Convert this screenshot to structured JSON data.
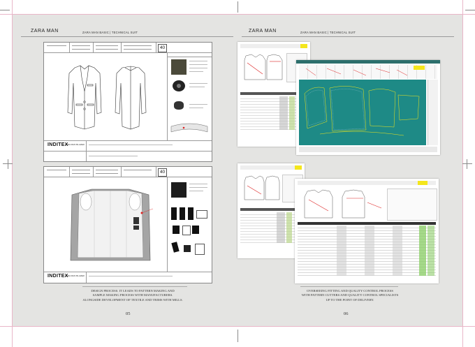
{
  "left_page": {
    "brand": "ZARA MAN",
    "subtitle": "ZARA MAN BASIC | TECHNICAL SUIT",
    "sheet_top": {
      "size_box": "40",
      "logo": "INDITEX",
      "logo_caption": "ZARA MAN BLAZER"
    },
    "sheet_bottom": {
      "size_box": "40",
      "logo": "INDITEX",
      "logo_caption": "ZARA MAN BLAZER"
    },
    "caption_lines": [
      "DESIGN PROCESS. IT LEADS TO PATTERN MAKING AND",
      "SAMPLE MAKING PROCESS WITH MANUFACTURERS.",
      "ALONGSIDE DEVELOPMENT OF TEXTILE AND TRIMS WITH MILLS."
    ],
    "page_number": "05"
  },
  "right_page": {
    "brand": "ZARA MAN",
    "subtitle": "ZARA MAN BASIC | TECHNICAL SUIT",
    "caption_lines": [
      "OVERSEEING FITTING AND QUALITY CONTROL PROCESS",
      "WITH PATTERN CUTTERS AND QUALITY CONTROL SPECIALISTS",
      "UP TO THE POINT OF DELIVERY."
    ],
    "page_number": "06"
  },
  "colors": {
    "spread_bg": "#e4e4e2",
    "bleed_line": "#e9b6c8",
    "pattern_teal": "#1e8a86",
    "highlight_yellow": "#f4e61c",
    "swatch_olive": "#4b4a3a",
    "lining_grey": "#9a9a9a"
  }
}
